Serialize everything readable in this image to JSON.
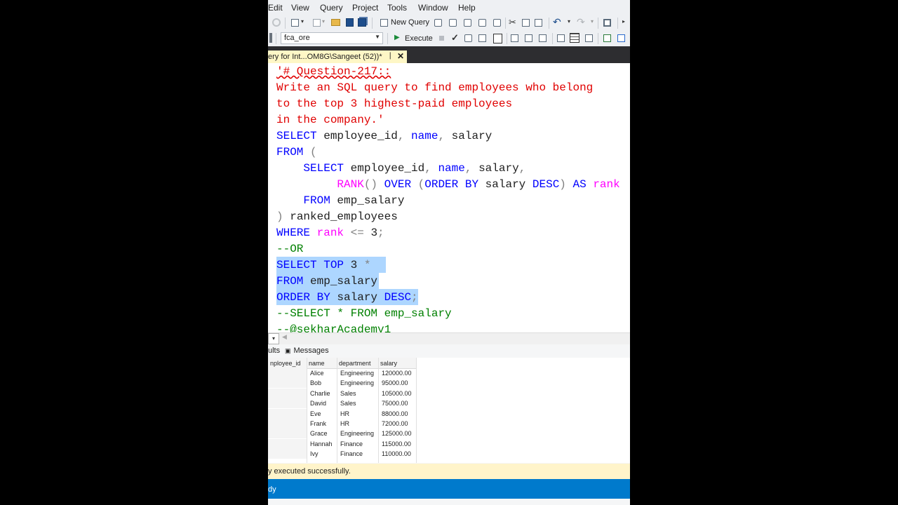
{
  "menu": [
    "Edit",
    "View",
    "Query",
    "Project",
    "Tools",
    "Window",
    "Help"
  ],
  "toolbar": {
    "new_query_label": "New Query",
    "database": "fca_ore",
    "execute_label": "Execute"
  },
  "tab": {
    "title": "ery for Int...OM8G\\Sangeet (52))*",
    "pin_icon": "❘",
    "close_icon": "✕"
  },
  "editor": {
    "lines": [
      {
        "segs": [
          {
            "t": "'# Question-217::",
            "c": "str squig"
          }
        ]
      },
      {
        "segs": [
          {
            "t": "Write an SQL query to find employees who belong",
            "c": "str"
          }
        ]
      },
      {
        "segs": [
          {
            "t": "to the top 3 highest-paid employees",
            "c": "str"
          }
        ]
      },
      {
        "segs": [
          {
            "t": "in the company.'",
            "c": "str"
          }
        ]
      },
      {
        "segs": [
          {
            "t": "SELECT",
            "c": "kw"
          },
          {
            "t": " employee_id",
            "c": "blk"
          },
          {
            "t": ",",
            "c": "gray"
          },
          {
            "t": " name",
            "c": "kw"
          },
          {
            "t": ",",
            "c": "gray"
          },
          {
            "t": " salary",
            "c": "blk"
          }
        ]
      },
      {
        "segs": [
          {
            "t": "FROM",
            "c": "kw"
          },
          {
            "t": " (",
            "c": "gray"
          }
        ]
      },
      {
        "segs": [
          {
            "t": "    SELECT",
            "c": "kw"
          },
          {
            "t": " employee_id",
            "c": "blk"
          },
          {
            "t": ",",
            "c": "gray"
          },
          {
            "t": " name",
            "c": "kw"
          },
          {
            "t": ",",
            "c": "gray"
          },
          {
            "t": " salary",
            "c": "blk"
          },
          {
            "t": ",",
            "c": "gray"
          }
        ]
      },
      {
        "segs": [
          {
            "t": "         RANK",
            "c": "fn"
          },
          {
            "t": "()",
            "c": "gray"
          },
          {
            "t": " OVER",
            "c": "kw"
          },
          {
            "t": " (",
            "c": "gray"
          },
          {
            "t": "ORDER BY",
            "c": "kw"
          },
          {
            "t": " salary",
            "c": "blk"
          },
          {
            "t": " DESC",
            "c": "kw"
          },
          {
            "t": ")",
            "c": "gray"
          },
          {
            "t": " AS",
            "c": "kw"
          },
          {
            "t": " rank",
            "c": "fn"
          }
        ]
      },
      {
        "segs": [
          {
            "t": "    FROM",
            "c": "kw"
          },
          {
            "t": " emp_salary",
            "c": "blk"
          }
        ]
      },
      {
        "segs": [
          {
            "t": ")",
            "c": "gray"
          },
          {
            "t": " ranked_employees",
            "c": "blk"
          }
        ]
      },
      {
        "segs": [
          {
            "t": "WHERE",
            "c": "kw"
          },
          {
            "t": " rank",
            "c": "fn"
          },
          {
            "t": " <=",
            "c": "gray"
          },
          {
            "t": " 3",
            "c": "blk"
          },
          {
            "t": ";",
            "c": "gray"
          }
        ]
      },
      {
        "segs": [
          {
            "t": "--OR",
            "c": "cmt"
          }
        ]
      },
      {
        "sel": 156,
        "segs": [
          {
            "t": "SELECT",
            "c": "kw"
          },
          {
            "t": " TOP",
            "c": "kw"
          },
          {
            "t": " 3",
            "c": "blk"
          },
          {
            "t": " *",
            "c": "gray"
          }
        ]
      },
      {
        "sel": 146,
        "segs": [
          {
            "t": "FROM",
            "c": "kw"
          },
          {
            "t": " emp_salary",
            "c": "blk"
          }
        ]
      },
      {
        "sel": 202,
        "segs": [
          {
            "t": "ORDER BY",
            "c": "kw"
          },
          {
            "t": " salary",
            "c": "blk"
          },
          {
            "t": " DESC",
            "c": "kw"
          },
          {
            "t": ";",
            "c": "gray"
          }
        ]
      },
      {
        "segs": [
          {
            "t": "--SELECT * FROM emp_salary",
            "c": "cmt"
          }
        ]
      },
      {
        "segs": [
          {
            "t": "--@sekharAcademy1",
            "c": "cmt"
          }
        ]
      }
    ]
  },
  "results": {
    "tab_results": "ults",
    "tab_messages": "Messages",
    "columns": [
      "nployee_id",
      "name",
      "department",
      "salary"
    ],
    "rows": [
      [
        "",
        "Alice",
        "Engineering",
        "120000.00"
      ],
      [
        "",
        "Bob",
        "Engineering",
        "95000.00"
      ],
      [
        "",
        "Charlie",
        "Sales",
        "105000.00"
      ],
      [
        "",
        "David",
        "Sales",
        "75000.00"
      ],
      [
        "",
        "Eve",
        "HR",
        "88000.00"
      ],
      [
        "",
        "Frank",
        "HR",
        "72000.00"
      ],
      [
        "",
        "Grace",
        "Engineering",
        "125000.00"
      ],
      [
        "",
        "Hannah",
        "Finance",
        "115000.00"
      ],
      [
        "",
        "Ivy",
        "Finance",
        "110000.00"
      ]
    ]
  },
  "status": {
    "message": "y executed successfully.",
    "bar": "dy"
  },
  "colors": {
    "accent": "#007acc",
    "tab_bg": "#2d2d30",
    "selection": "#add6ff",
    "success_bg": "#fff4ca"
  }
}
